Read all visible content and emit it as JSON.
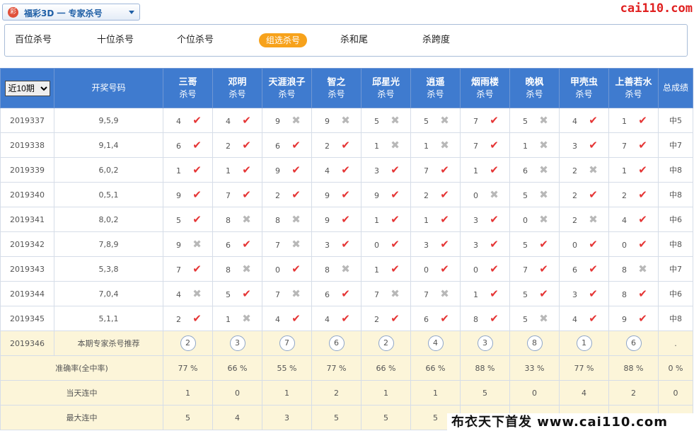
{
  "header": {
    "logo": "彩",
    "title": "福彩3D 一 专家杀号",
    "brand": "cai110.com"
  },
  "tabs": [
    "百位杀号",
    "十位杀号",
    "个位杀号",
    "组选杀号",
    "杀和尾",
    "杀跨度"
  ],
  "active_tab": 3,
  "table": {
    "period_select": "近10期",
    "col_draw": "开奖号码",
    "sub": "杀号",
    "col_total": "总成绩",
    "experts": [
      "三哥",
      "邓明",
      "天涯浪子",
      "智之",
      "邱星光",
      "逍遥",
      "烟雨楼",
      "晚枫",
      "甲壳虫",
      "上善若水"
    ],
    "rows": [
      {
        "issue": "2019337",
        "draw": "9,5,9",
        "kills": [
          "4",
          "4",
          "9",
          "9",
          "5",
          "5",
          "7",
          "5",
          "4",
          "1"
        ],
        "hit": [
          1,
          1,
          0,
          0,
          0,
          0,
          1,
          0,
          1,
          1
        ],
        "total": "中5"
      },
      {
        "issue": "2019338",
        "draw": "9,1,4",
        "kills": [
          "6",
          "2",
          "6",
          "2",
          "1",
          "1",
          "7",
          "1",
          "3",
          "7"
        ],
        "hit": [
          1,
          1,
          1,
          1,
          0,
          0,
          1,
          0,
          1,
          1
        ],
        "total": "中7"
      },
      {
        "issue": "2019339",
        "draw": "6,0,2",
        "kills": [
          "1",
          "1",
          "9",
          "4",
          "3",
          "7",
          "1",
          "6",
          "2",
          "1"
        ],
        "hit": [
          1,
          1,
          1,
          1,
          1,
          1,
          1,
          0,
          0,
          1
        ],
        "total": "中8"
      },
      {
        "issue": "2019340",
        "draw": "0,5,1",
        "kills": [
          "9",
          "7",
          "2",
          "9",
          "9",
          "2",
          "0",
          "5",
          "2",
          "2"
        ],
        "hit": [
          1,
          1,
          1,
          1,
          1,
          1,
          0,
          0,
          1,
          1
        ],
        "total": "中8"
      },
      {
        "issue": "2019341",
        "draw": "8,0,2",
        "kills": [
          "5",
          "8",
          "8",
          "9",
          "1",
          "1",
          "3",
          "0",
          "2",
          "4"
        ],
        "hit": [
          1,
          0,
          0,
          1,
          1,
          1,
          1,
          0,
          0,
          1
        ],
        "total": "中6"
      },
      {
        "issue": "2019342",
        "draw": "7,8,9",
        "kills": [
          "9",
          "6",
          "7",
          "3",
          "0",
          "3",
          "3",
          "5",
          "0",
          "0"
        ],
        "hit": [
          0,
          1,
          0,
          1,
          1,
          1,
          1,
          1,
          1,
          1
        ],
        "total": "中8"
      },
      {
        "issue": "2019343",
        "draw": "5,3,8",
        "kills": [
          "7",
          "8",
          "0",
          "8",
          "1",
          "0",
          "0",
          "7",
          "6",
          "8"
        ],
        "hit": [
          1,
          0,
          1,
          0,
          1,
          1,
          1,
          1,
          1,
          0
        ],
        "total": "中7"
      },
      {
        "issue": "2019344",
        "draw": "7,0,4",
        "kills": [
          "4",
          "5",
          "7",
          "6",
          "7",
          "7",
          "1",
          "5",
          "3",
          "8"
        ],
        "hit": [
          0,
          1,
          0,
          1,
          0,
          0,
          1,
          1,
          1,
          1
        ],
        "total": "中6"
      },
      {
        "issue": "2019345",
        "draw": "5,1,1",
        "kills": [
          "2",
          "1",
          "4",
          "4",
          "2",
          "6",
          "8",
          "5",
          "4",
          "9"
        ],
        "hit": [
          1,
          0,
          1,
          1,
          1,
          1,
          1,
          0,
          1,
          1
        ],
        "total": "中8"
      }
    ],
    "rec": {
      "issue": "2019346",
      "label": "本期专家杀号推荐",
      "nums": [
        "2",
        "3",
        "7",
        "6",
        "2",
        "4",
        "3",
        "8",
        "1",
        "6"
      ],
      "total": "."
    },
    "stats": [
      {
        "label": "准确率(全中率)",
        "vals": [
          "77 %",
          "66 %",
          "55 %",
          "77 %",
          "66 %",
          "66 %",
          "88 %",
          "33 %",
          "77 %",
          "88 %"
        ],
        "total": "0 %"
      },
      {
        "label": "当天连中",
        "vals": [
          "1",
          "0",
          "1",
          "2",
          "1",
          "1",
          "5",
          "0",
          "4",
          "2"
        ],
        "total": "0"
      },
      {
        "label": "最大连中",
        "vals": [
          "5",
          "4",
          "3",
          "5",
          "5",
          "5",
          "",
          "",
          "",
          ""
        ],
        "total": ""
      }
    ]
  },
  "watermark": "布衣天下首发 www.cai110.com"
}
